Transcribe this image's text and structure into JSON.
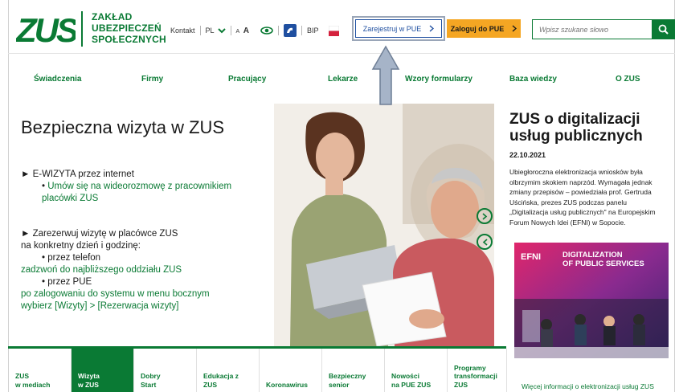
{
  "header": {
    "logo_text": "ZUS",
    "org_lines": [
      "ZAKŁAD",
      "UBEZPIECZEŃ",
      "SPOŁECZNYCH"
    ],
    "contact_label": "Kontakt",
    "language": "PL",
    "font_size_label": "A A",
    "bip_label": "BIP",
    "register_label": "Zarejestruj w PUE",
    "login_label": "Zaloguj do PUE",
    "search_placeholder": "Wpisz szukane słowo"
  },
  "nav": [
    "Świadczenia",
    "Firmy",
    "Pracujący",
    "Lekarze",
    "Wzory formularzy",
    "Baza wiedzy",
    "O ZUS"
  ],
  "promo": {
    "title": "Bezpieczna wizyta w ZUS",
    "section1_heading": "► E-WIZYTA przez internet",
    "section1_link_line1": "Umów się na wideorozmowę z pracownikiem",
    "section1_link_line2": "placówki ZUS",
    "section2_heading": "► Zarezerwuj wizytę w placówce ZUS",
    "section2_sub": "na konkretny dzień i godzinę:",
    "phone_label": "przez telefon",
    "phone_link": "zadzwoń do najbliższego oddziału ZUS",
    "pue_label": "przez PUE",
    "pue_line1": "po zalogowaniu do systemu w menu bocznym",
    "pue_line2": "wybierz [Wizyty] > [Rezerwacja wizyty]"
  },
  "news": {
    "title": "ZUS o digitalizacji usług publicznych",
    "date": "22.10.2021",
    "body": "Ubiegłoroczna elektronizacja wniosków była olbrzymim skokiem naprzód. Wymagała jednak zmiany przepisów – powiedziała prof. Gertruda Uścińska, prezes ZUS podczas panelu „Digitalizacja usług publicznych\" na Europejskim Forum Nowych Idei (EFNI) w Sopocie.",
    "image_text_efni": "EFNI",
    "image_text_line1": "DIGITALIZATION",
    "image_text_line2": "OF PUBLIC SERVICES",
    "link": "Więcej informacji o elektronizacji usług ZUS"
  },
  "tabs": [
    {
      "label1": "ZUS",
      "label2": "w mediach",
      "label3": ""
    },
    {
      "label1": "Wizyta",
      "label2": "w ZUS",
      "label3": ""
    },
    {
      "label1": "Dobry",
      "label2": "Start",
      "label3": ""
    },
    {
      "label1": "Edukacja z",
      "label2": "ZUS",
      "label3": ""
    },
    {
      "label1": "Koronawirus",
      "label2": "",
      "label3": ""
    },
    {
      "label1": "Bezpieczny",
      "label2": "senior",
      "label3": ""
    },
    {
      "label1": "Nowości",
      "label2": "na PUE ZUS",
      "label3": ""
    },
    {
      "label1": "Programy",
      "label2": "transformacji",
      "label3": "ZUS"
    }
  ],
  "colors": {
    "brand_green": "#0a7a34",
    "login_orange": "#f5a623",
    "register_blue": "#1f4fa0",
    "annotation_arrow": "#a6b4c8"
  },
  "icons": [
    "chevron-down-icon",
    "eye-icon",
    "sign-language-icon",
    "poland-flag-icon",
    "chevron-right-icon",
    "search-icon",
    "arrow-up-icon",
    "slider-prev-icon",
    "slider-next-icon"
  ]
}
